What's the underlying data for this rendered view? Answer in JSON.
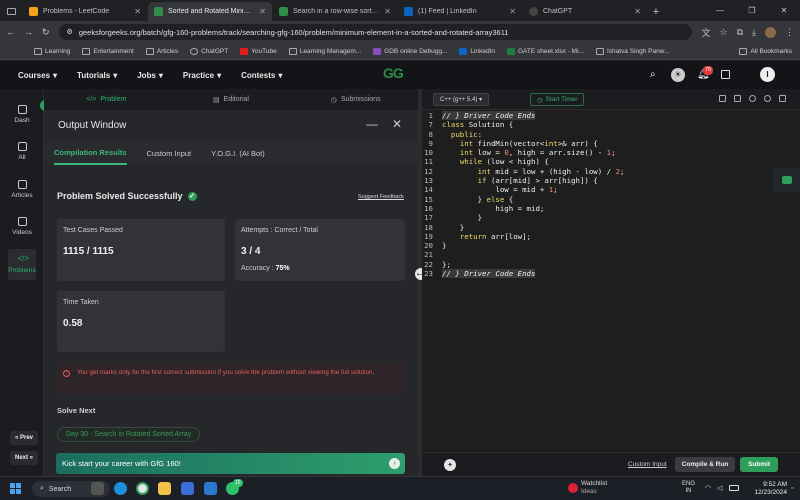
{
  "browser": {
    "tabs": [
      {
        "title": "Problems - LeetCode",
        "color": "#f89f1b"
      },
      {
        "title": "Sorted and Rotated Minimum | ",
        "color": "#2f8d46",
        "active": true
      },
      {
        "title": "Search in a row-wise sorted m",
        "color": "#2f8d46"
      },
      {
        "title": "(1) Feed | LinkedIn",
        "color": "#0a66c2"
      },
      {
        "title": "ChatGPT",
        "color": "#444"
      }
    ],
    "new_tab": "+",
    "url": "geeksforgeeks.org/batch/gfg-160-problems/track/searching-gfg-160/problem/minimum-element-in-a-sorted-and-rotated-array3611",
    "bookmarks": [
      "Learning",
      "Entertainment",
      "Articles",
      "ChatGPT",
      "YouTube",
      "Learning Managem...",
      "GDB online Debugg...",
      "LinkedIn",
      "GATE sheet.xlsx - Mi...",
      "Ishatva Singh Panw..."
    ],
    "all_bookmarks": "All Bookmarks"
  },
  "nav": {
    "items": [
      "Courses",
      "Tutorials",
      "Jobs",
      "Practice",
      "Contests"
    ],
    "logo": "GG",
    "notif_count": "70"
  },
  "rail": {
    "items": [
      "Dash",
      "All",
      "Articles",
      "Videos",
      "Problems"
    ],
    "prev": "Prev",
    "next": "Next"
  },
  "panel": {
    "tabs": [
      "Problem",
      "Editorial",
      "Submissions"
    ],
    "output_title": "Output Window",
    "subtabs": [
      "Compilation Results",
      "Custom Input",
      "Y.O.G.I. (AI Bot)"
    ],
    "status": "Problem Solved Successfully",
    "suggest_feedback": "Suggest Feedback",
    "test_cases_label": "Test Cases Passed",
    "test_cases_value": "1115 / 1115",
    "attempts_label": "Attempts : Correct / Total",
    "attempts_value": "3 / 4",
    "accuracy_label": "Accuracy :",
    "accuracy_value": "75%",
    "time_label": "Time Taken",
    "time_value": "0.58",
    "warning": "You get marks only for the first correct submission if you solve the problem without viewing the full solution.",
    "solve_next": "Solve Next",
    "next_problem": "Day 30 - Search in Rotated Sorted Array",
    "kickstart": "Kick start your career with GfG 160!"
  },
  "editor": {
    "language": "C++ (g++ 5.4)",
    "timer": "Start Timer",
    "lines": [
      {
        "n": "1",
        "t": "// } Driver Code Ends",
        "cls": "cm",
        "hl": true
      },
      {
        "n": "7",
        "t": "class Solution {"
      },
      {
        "n": "8",
        "t": "  public:"
      },
      {
        "n": "9",
        "t": "    int findMin(vector<int>& arr) {"
      },
      {
        "n": "10",
        "t": "    int low = 0, high = arr.size() - 1;"
      },
      {
        "n": "11",
        "t": "    while (low < high) {"
      },
      {
        "n": "12",
        "t": "        int mid = low + (high - low) / 2;"
      },
      {
        "n": "13",
        "t": "        if (arr[mid] > arr[high]) {"
      },
      {
        "n": "14",
        "t": "            low = mid + 1;"
      },
      {
        "n": "15",
        "t": "        } else {"
      },
      {
        "n": "16",
        "t": "            high = mid;"
      },
      {
        "n": "17",
        "t": "        }"
      },
      {
        "n": "18",
        "t": "    }"
      },
      {
        "n": "19",
        "t": "    return arr[low];"
      },
      {
        "n": "20",
        "t": "}"
      },
      {
        "n": "21",
        "t": ""
      },
      {
        "n": "22",
        "t": "};"
      },
      {
        "n": "23",
        "t": "// } Driver Code Ends",
        "cls": "cm",
        "hl": true
      }
    ],
    "custom_input": "Custom Input",
    "compile": "Compile & Run",
    "submit": "Submit"
  },
  "taskbar": {
    "search": "Search",
    "watchlist": "Watchlist",
    "watchlist_sub": "Ideas",
    "lang": "ENG",
    "region": "IN",
    "time": "9:52 AM",
    "date": "12/23/2024",
    "chrome_badge": "15"
  }
}
